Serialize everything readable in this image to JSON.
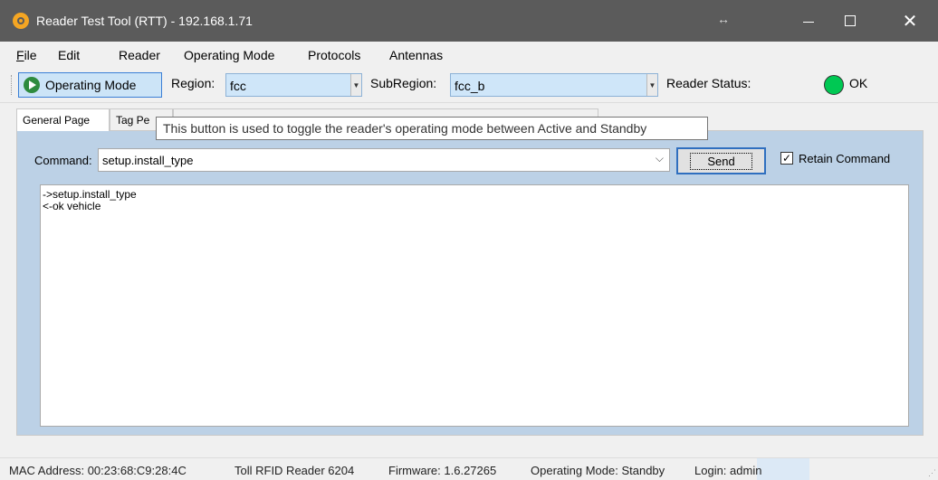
{
  "window": {
    "title": "Reader Test Tool (RTT) - 192.168.1.71",
    "resize_glyph": "↔",
    "close_glyph": "✕"
  },
  "menu": {
    "file_u": "F",
    "file_rest": "ile",
    "edit": "Edit",
    "reader": "Reader",
    "operating_mode": "Operating Mode",
    "protocols": "Protocols",
    "antennas": "Antennas"
  },
  "toolbar": {
    "operating_mode_button": "Operating Mode",
    "region_label": "Region:",
    "region_value": "fcc",
    "subregion_label": "SubRegion:",
    "subregion_value": "fcc_b",
    "reader_status_label": "Reader Status:",
    "reader_status_value": "OK",
    "status_color": "#00c853"
  },
  "tabs": {
    "general_page": "General Page",
    "tag_partial": "Tag Pe"
  },
  "tooltip": "This button is used to toggle the reader's operating mode between Active and Standby",
  "command": {
    "label": "Command:",
    "value": "setup.install_type",
    "send_label": "Send",
    "retain_label": "Retain Command",
    "retain_checked": "✓"
  },
  "output_lines": [
    "->setup.install_type",
    "<-ok vehicle"
  ],
  "statusbar": {
    "mac": "MAC Address: 00:23:68:C9:28:4C",
    "device": "Toll RFID Reader 6204",
    "firmware": "Firmware: 1.6.27265",
    "mode": "Operating Mode: Standby",
    "login": "Login: admin"
  }
}
